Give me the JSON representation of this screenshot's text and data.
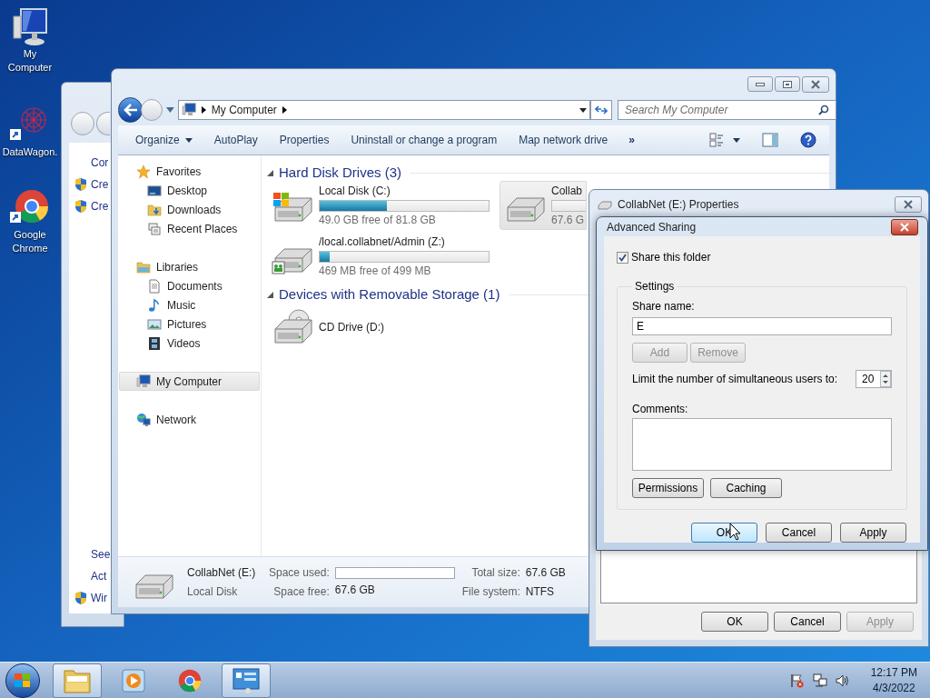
{
  "desktop_icons": [
    {
      "label": "My Computer",
      "kind": "computer"
    },
    {
      "label": "DataWagon.",
      "kind": "mesh"
    },
    {
      "label": "Google Chrome",
      "kind": "browser"
    }
  ],
  "background_window": {
    "lines": [
      {
        "text": "Cor",
        "shield": false
      },
      {
        "text": "Cre",
        "shield": true
      },
      {
        "text": "Cre",
        "shield": true
      },
      {
        "text": "See",
        "shield": false
      },
      {
        "text": "Act",
        "shield": false
      },
      {
        "text": "Wir",
        "shield": true
      }
    ]
  },
  "explorer": {
    "address": "My Computer",
    "search": {
      "placeholder": "Search My Computer"
    },
    "toolbar": [
      {
        "label": "Organize",
        "kind": "menu"
      },
      {
        "label": "AutoPlay",
        "kind": "command"
      },
      {
        "label": "Properties",
        "kind": "command"
      },
      {
        "label": "Uninstall or change a program",
        "kind": "command"
      },
      {
        "label": "Map network drive",
        "kind": "command"
      },
      {
        "label": "»",
        "kind": "overflow"
      }
    ],
    "nav": [
      {
        "label": "Favorites",
        "kind": "star",
        "selected": false,
        "children": [
          {
            "label": "Desktop",
            "kind": "desktop",
            "selected": false
          },
          {
            "label": "Downloads",
            "kind": "downloads",
            "selected": false
          },
          {
            "label": "Recent Places",
            "kind": "recent",
            "selected": false
          }
        ]
      },
      {
        "label": "Libraries",
        "kind": "library",
        "selected": false,
        "children": [
          {
            "label": "Documents",
            "kind": "document",
            "selected": false
          },
          {
            "label": "Music",
            "kind": "music",
            "selected": false
          },
          {
            "label": "Pictures",
            "kind": "pictures",
            "selected": false
          },
          {
            "label": "Videos",
            "kind": "videos",
            "selected": false
          }
        ]
      },
      {
        "label": "My Computer",
        "kind": "computer",
        "selected": true
      },
      {
        "label": "Network",
        "kind": "network",
        "selected": false
      }
    ],
    "groups": [
      {
        "title": "Hard Disk Drives (3)",
        "items": [
          {
            "name": "Local Disk (C:)",
            "kind": "windows_drive",
            "level": 0.4,
            "free": "49.0 GB free of 81.8 GB",
            "selected": false
          },
          {
            "name": "Collab",
            "kind": "drive",
            "free": "67.6 G",
            "selected": true
          },
          {
            "name": "/local.collabnet/Admin (Z:)",
            "kind": "network_drive",
            "level": 0.06,
            "free": "469 MB free of 499 MB",
            "selected": false
          }
        ]
      },
      {
        "title": "Devices with Removable Storage (1)",
        "items": [
          {
            "name": "CD Drive (D:)",
            "kind": "cd_drive",
            "selected": false
          }
        ]
      }
    ],
    "details": {
      "name": "CollabNet (E:)",
      "type": "Local Disk",
      "used": {
        "label": "Space used:"
      },
      "free": {
        "label": "Space free:",
        "value": "67.6 GB"
      },
      "total": {
        "label": "Total size:",
        "value": "67.6 GB"
      },
      "fs": {
        "label": "File system:",
        "value": "NTFS"
      }
    }
  },
  "properties_dialog": {
    "title": "CollabNet (E:) Properties",
    "buttons": [
      {
        "label": "OK",
        "disabled": false
      },
      {
        "label": "Cancel",
        "disabled": false
      },
      {
        "label": "Apply",
        "disabled": true
      }
    ]
  },
  "advanced_sharing": {
    "title": "Advanced Sharing",
    "share_folder": {
      "label": "Share this folder",
      "checked": true
    },
    "group_label": "Settings",
    "share_name": {
      "label": "Share name:",
      "value": "E"
    },
    "name_buttons": [
      {
        "label": "Add",
        "disabled": true
      },
      {
        "label": "Remove",
        "disabled": true
      }
    ],
    "user_limit": {
      "label": "Limit the number of simultaneous users to:",
      "value": "20"
    },
    "comments": {
      "label": "Comments:"
    },
    "option_buttons": [
      {
        "label": "Permissions"
      },
      {
        "label": "Caching"
      }
    ],
    "buttons": [
      {
        "label": "OK",
        "highlighted": true
      },
      {
        "label": "Cancel",
        "highlighted": false
      },
      {
        "label": "Apply",
        "highlighted": false
      }
    ]
  },
  "taskbar": {
    "items": [
      {
        "kind": "explorer",
        "active": true
      },
      {
        "kind": "media_player",
        "active": false
      },
      {
        "kind": "browser",
        "active": false
      },
      {
        "kind": "control_panel",
        "active": true
      }
    ],
    "clock": {
      "time": "12:17 PM",
      "date": "4/3/2022"
    }
  }
}
